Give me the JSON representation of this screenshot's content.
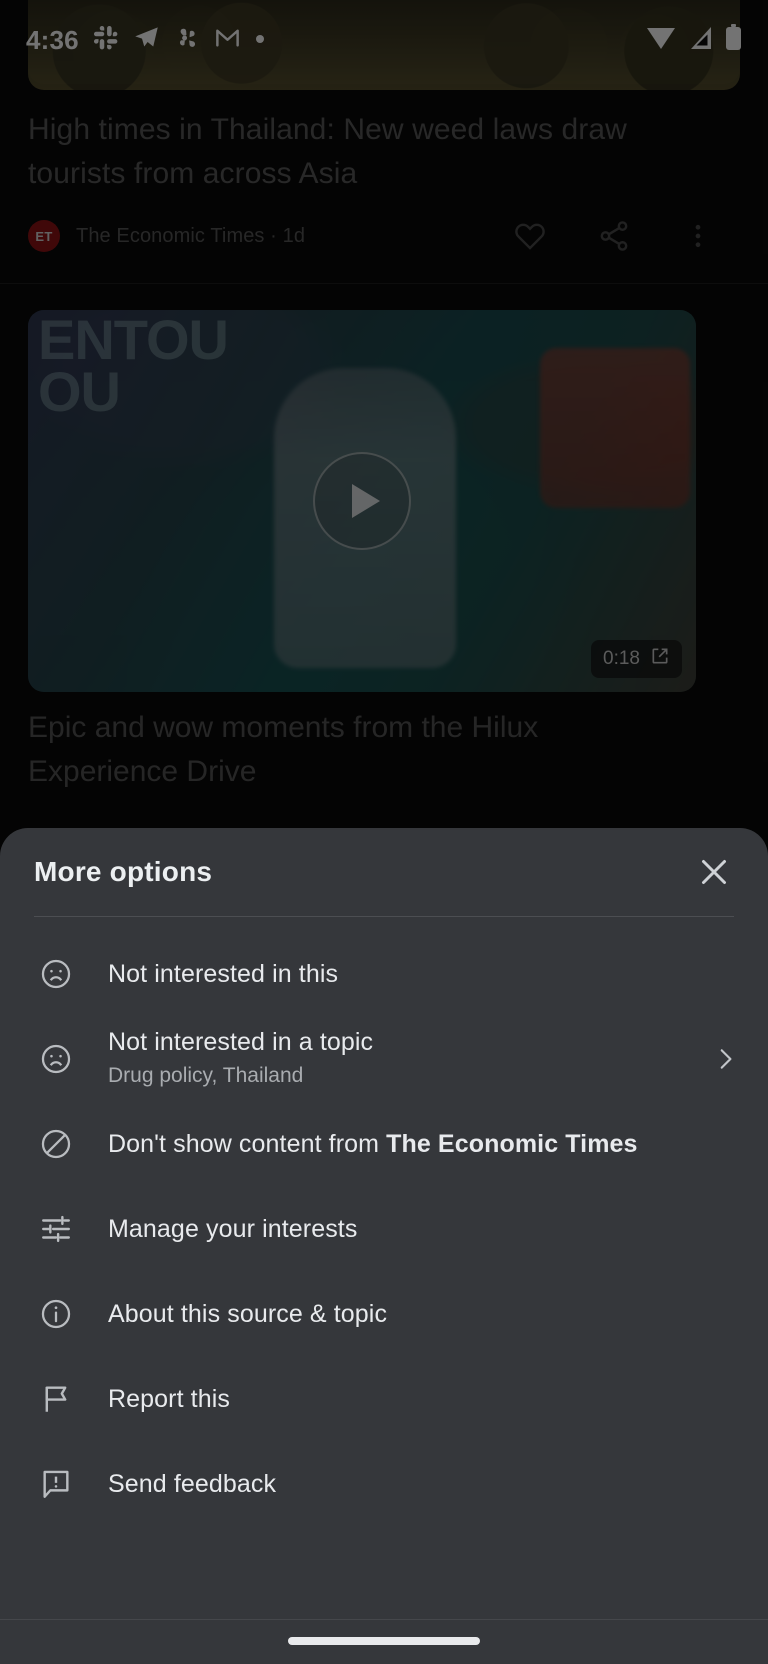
{
  "status_bar": {
    "time": "4:36",
    "left_icons": [
      "slack-icon",
      "telegram-icon",
      "app-icon",
      "gmail-icon",
      "dot-icon"
    ],
    "right_icons": [
      "wifi-icon",
      "cellular-signal-icon",
      "battery-icon"
    ]
  },
  "feed": {
    "article": {
      "headline": "High times in Thailand: New weed laws draw tourists from across Asia",
      "source_initials": "ET",
      "source_line": "The Economic Times · 1d",
      "actions": [
        "heart-icon",
        "share-icon",
        "more-options-icon"
      ]
    },
    "video": {
      "overlay_text_line1": "ENTOU",
      "overlay_text_line2": "OU",
      "duration": "0:18",
      "title": "Epic and wow moments from the Hilux Experience Drive"
    }
  },
  "sheet": {
    "title": "More options",
    "close_icon": "close-icon",
    "items": [
      {
        "icon": "sad-face-icon",
        "label": "Not interested in this",
        "sub": null,
        "chevron": false
      },
      {
        "icon": "sad-face-icon",
        "label": "Not interested in a topic",
        "sub": "Drug policy, Thailand",
        "chevron": true
      },
      {
        "icon": "block-icon",
        "label_prefix": "Don't show content from ",
        "label_bold": "The Economic Times",
        "sub": null,
        "chevron": false
      },
      {
        "icon": "tune-icon",
        "label": "Manage your interests",
        "sub": null,
        "chevron": false
      },
      {
        "icon": "info-icon",
        "label": "About this source & topic",
        "sub": null,
        "chevron": false
      },
      {
        "icon": "flag-icon",
        "label": "Report this",
        "sub": null,
        "chevron": false
      },
      {
        "icon": "feedback-icon",
        "label": "Send feedback",
        "sub": null,
        "chevron": false
      }
    ]
  },
  "colors": {
    "sheet_bg": "#35373b",
    "sheet_text": "#e8eaed",
    "sheet_subtext": "#a9acb0",
    "source_logo_bg": "#8e1215",
    "page_bg": "#0a0a0a"
  }
}
